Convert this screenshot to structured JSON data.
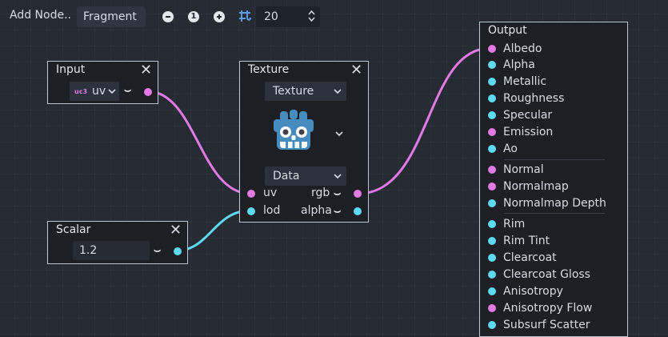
{
  "toolbar": {
    "add_node_label": "Add Node..",
    "shader_mode": "Fragment",
    "zoom_reset_label": "1",
    "snap_distance": "20",
    "icons": [
      "zoom-out-icon",
      "zoom-reset-icon",
      "zoom-in-icon",
      "snap-grid-icon"
    ]
  },
  "nodes": {
    "input": {
      "title": "Input",
      "type_badge": "uc3",
      "value": "uv"
    },
    "texture": {
      "title": "Texture",
      "source": "Texture",
      "type": "Data",
      "in_ports": [
        "uv",
        "lod"
      ],
      "out_ports": [
        "rgb",
        "alpha"
      ]
    },
    "scalar": {
      "title": "Scalar",
      "value": "1.2"
    },
    "output": {
      "title": "Output",
      "ports": [
        "Albedo",
        "Alpha",
        "Metallic",
        "Roughness",
        "Specular",
        "Emission",
        "Ao",
        "Normal",
        "Normalmap",
        "Normalmap Depth",
        "Rim",
        "Rim Tint",
        "Clearcoat",
        "Clearcoat Gloss",
        "Anisotropy",
        "Anisotropy Flow",
        "Subsurf Scatter"
      ]
    }
  },
  "colors": {
    "vec3_port": "#e27ae4",
    "scalar_port": "#5fd9f0",
    "accent": "#5e9ae8"
  }
}
